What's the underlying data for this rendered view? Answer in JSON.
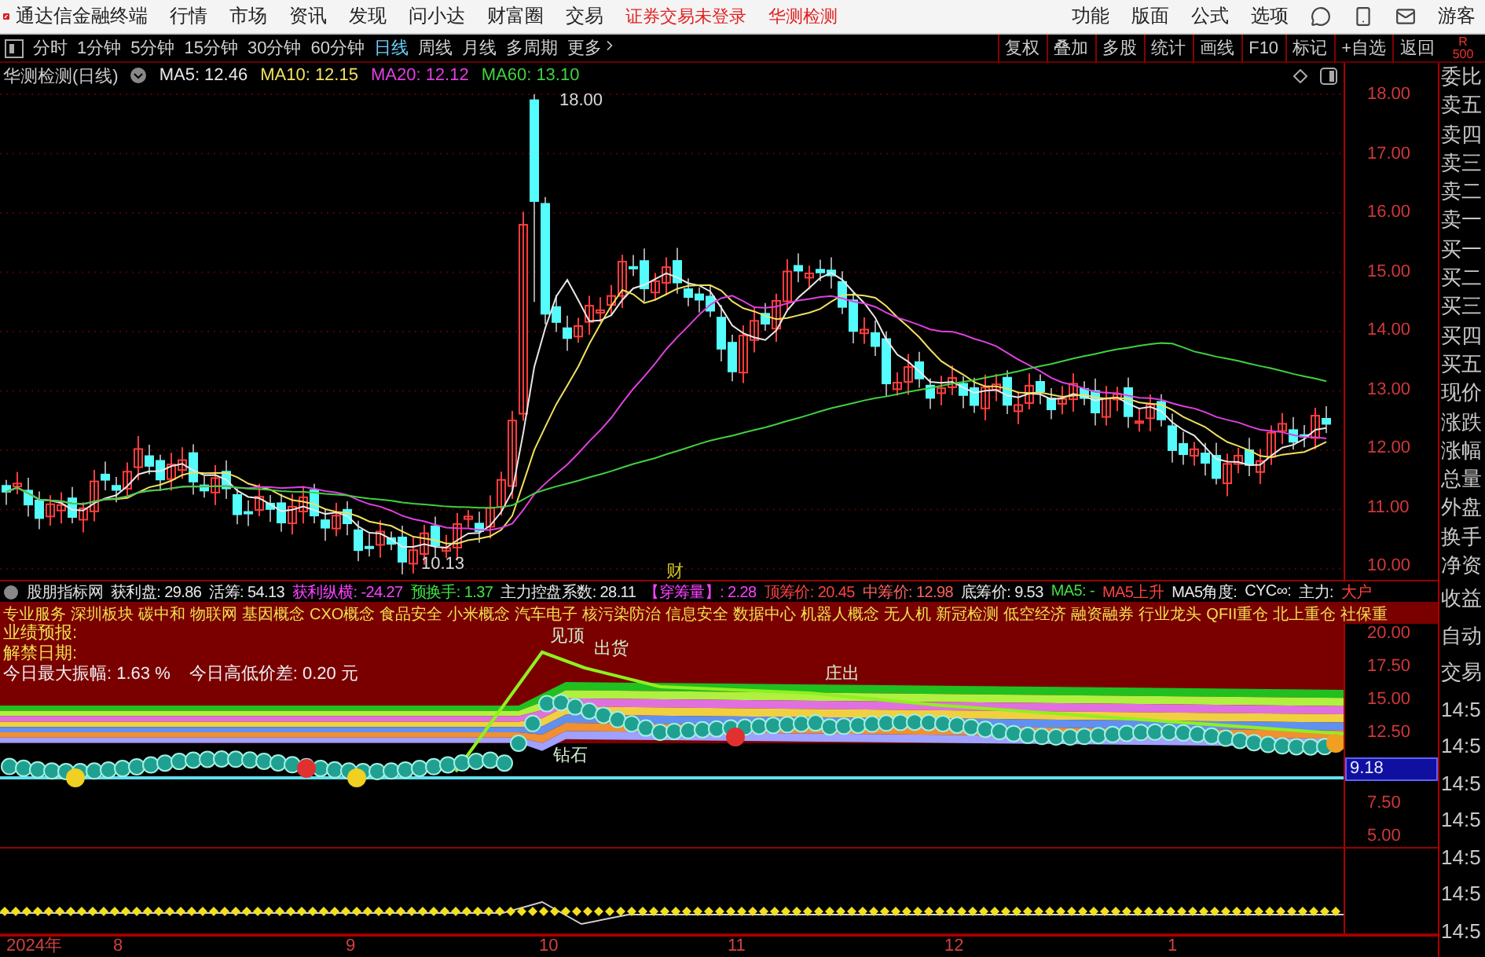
{
  "app": {
    "title": "通达信金融终端"
  },
  "menu": [
    "行情",
    "市场",
    "资讯",
    "发现",
    "问小达",
    "财富圈",
    "交易"
  ],
  "notices": [
    "证券交易未登录",
    "华测检测"
  ],
  "menu_right": [
    "功能",
    "版面",
    "公式",
    "选项"
  ],
  "user": "游客",
  "periods": [
    {
      "label": "分时",
      "selected": false
    },
    {
      "label": "1分钟",
      "selected": false
    },
    {
      "label": "5分钟",
      "selected": false
    },
    {
      "label": "15分钟",
      "selected": false
    },
    {
      "label": "30分钟",
      "selected": false
    },
    {
      "label": "60分钟",
      "selected": false
    },
    {
      "label": "日线",
      "selected": true
    },
    {
      "label": "周线",
      "selected": false
    },
    {
      "label": "月线",
      "selected": false
    },
    {
      "label": "多周期",
      "selected": false
    }
  ],
  "more": "更多",
  "tools": [
    "复权",
    "叠加",
    "多股",
    "统计",
    "画线",
    "F10",
    "标记",
    "+自选",
    "返回"
  ],
  "corner": [
    "R",
    "500"
  ],
  "main_chart": {
    "title": "华测检测(日线)",
    "ma": [
      {
        "text": "MA5: 12.46",
        "color": "#e8e8e8"
      },
      {
        "text": "MA10: 12.15",
        "color": "#f0e060"
      },
      {
        "text": "MA20: 12.12",
        "color": "#e040e0"
      },
      {
        "text": "MA60: 13.10",
        "color": "#40d040"
      }
    ],
    "price_axis": [
      "18.00",
      "17.00",
      "16.00",
      "15.00",
      "14.00",
      "13.00",
      "12.00",
      "11.00",
      "10.00"
    ],
    "high_label": "18.00",
    "low_label": "10.13",
    "event_mark": "财"
  },
  "indicator": {
    "name": "股朋指标网",
    "fields": [
      {
        "text": "获利盘: 29.86",
        "color": "#e8e8e8"
      },
      {
        "text": "活筹: 54.13",
        "color": "#e8e8e8"
      },
      {
        "text": "获利纵横: -24.27",
        "color": "#ff40ff"
      },
      {
        "text": "预换手: 1.37",
        "color": "#40e040"
      },
      {
        "text": "主力控盘系数: 28.11",
        "color": "#e8e8e8"
      },
      {
        "text": "【穿筹量】: 2.28",
        "color": "#ff40ff"
      },
      {
        "text": "顶筹价: 20.45",
        "color": "#ff4040"
      },
      {
        "text": "中筹价: 12.98",
        "color": "#ff6060"
      },
      {
        "text": "底筹价: 9.53",
        "color": "#e8e8e8"
      },
      {
        "text": "MA5: -",
        "color": "#40e040"
      },
      {
        "text": "MA5上升",
        "color": "#ff4040"
      },
      {
        "text": "MA5角度:",
        "color": "#e8e8e8"
      },
      {
        "text": "CYC∞:",
        "color": "#e8e8e8"
      },
      {
        "text": "主力:",
        "color": "#e8e8e8"
      },
      {
        "text": "大户",
        "color": "#ff4040"
      }
    ],
    "concepts": [
      "专业服务",
      "深圳板块",
      "碳中和",
      "物联网",
      "基因概念",
      "CXO概念",
      "食品安全",
      "小米概念",
      "汽车电子",
      "核污染防治",
      "信息安全",
      "数据中心",
      "机器人概念",
      "无人机",
      "新冠检测",
      "低空经济",
      "融资融券",
      "行业龙头",
      "QFII重仓",
      "北上重仓",
      "社保重"
    ],
    "notes": [
      "业绩预报:",
      "解禁日期:"
    ],
    "stats": [
      "今日最大振幅: 1.63 %",
      "今日高低价差: 0.20 元"
    ],
    "signals": [
      {
        "text": "见顶",
        "kind": "top"
      },
      {
        "text": "出货",
        "kind": "sell"
      },
      {
        "text": "庄出",
        "kind": "exit"
      },
      {
        "text": "钻石",
        "kind": "gem"
      }
    ],
    "axis": [
      {
        "label": "20.00",
        "current": false
      },
      {
        "label": "17.50",
        "current": false
      },
      {
        "label": "15.00",
        "current": false
      },
      {
        "label": "12.50",
        "current": false
      },
      {
        "label": "9.18",
        "current": true
      },
      {
        "label": "7.50",
        "current": false
      },
      {
        "label": "5.00",
        "current": false
      }
    ]
  },
  "date_axis": [
    "2024年",
    "8",
    "9",
    "10",
    "11",
    "12",
    "1"
  ],
  "side_panel": [
    "委比",
    "卖五",
    "卖四",
    "卖三",
    "卖二",
    "卖一",
    "买一",
    "买二",
    "买三",
    "买四",
    "买五",
    "现价",
    "涨跌",
    "涨幅",
    "总量",
    "外盘",
    "换手",
    "净资"
  ],
  "side_lower": [
    "收益",
    "自动",
    "交易",
    "14:5",
    "14:5",
    "14:5",
    "14:5",
    "14:5",
    "14:5",
    "14:5"
  ]
}
